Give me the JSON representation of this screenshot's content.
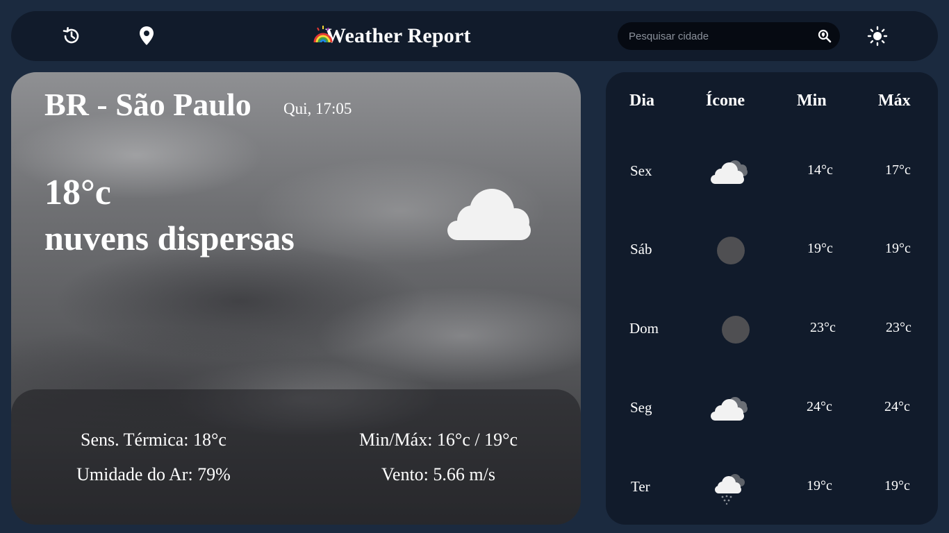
{
  "header": {
    "title": "Weather Report",
    "search": {
      "placeholder": "Pesquisar cidade",
      "value": ""
    },
    "icons": [
      "history-icon",
      "location-pin-icon",
      "search-location-icon",
      "sun-theme-icon"
    ]
  },
  "current": {
    "location": "BR - São Paulo",
    "datetime": "Qui, 17:05",
    "temperature": "18°c",
    "description": "nuvens dispersas",
    "icon": "scattered-clouds-icon",
    "stats": {
      "feels_like": "Sens. Térmica: 18°c",
      "min_max": "Min/Máx: 16°c / 19°c",
      "humidity": "Umidade do Ar: 79%",
      "wind": "Vento: 5.66 m/s"
    }
  },
  "forecast": {
    "headers": {
      "day": "Dia",
      "icon": "Ícone",
      "min": "Min",
      "max": "Máx"
    },
    "days": [
      {
        "day": "Sex",
        "icon": "broken-clouds-icon",
        "min": "14°c",
        "max": "17°c"
      },
      {
        "day": "Sáb",
        "icon": "overcast-icon",
        "min": "19°c",
        "max": "19°c"
      },
      {
        "day": "Dom",
        "icon": "overcast-icon",
        "min": "23°c",
        "max": "23°c"
      },
      {
        "day": "Seg",
        "icon": "broken-clouds-icon",
        "min": "24°c",
        "max": "24°c"
      },
      {
        "day": "Ter",
        "icon": "light-rain-icon",
        "min": "19°c",
        "max": "19°c"
      }
    ]
  },
  "colors": {
    "page_bg": "#1b2a3f",
    "panel_bg": "#111b2b",
    "search_bg": "#060a12",
    "text": "#ffffff"
  }
}
